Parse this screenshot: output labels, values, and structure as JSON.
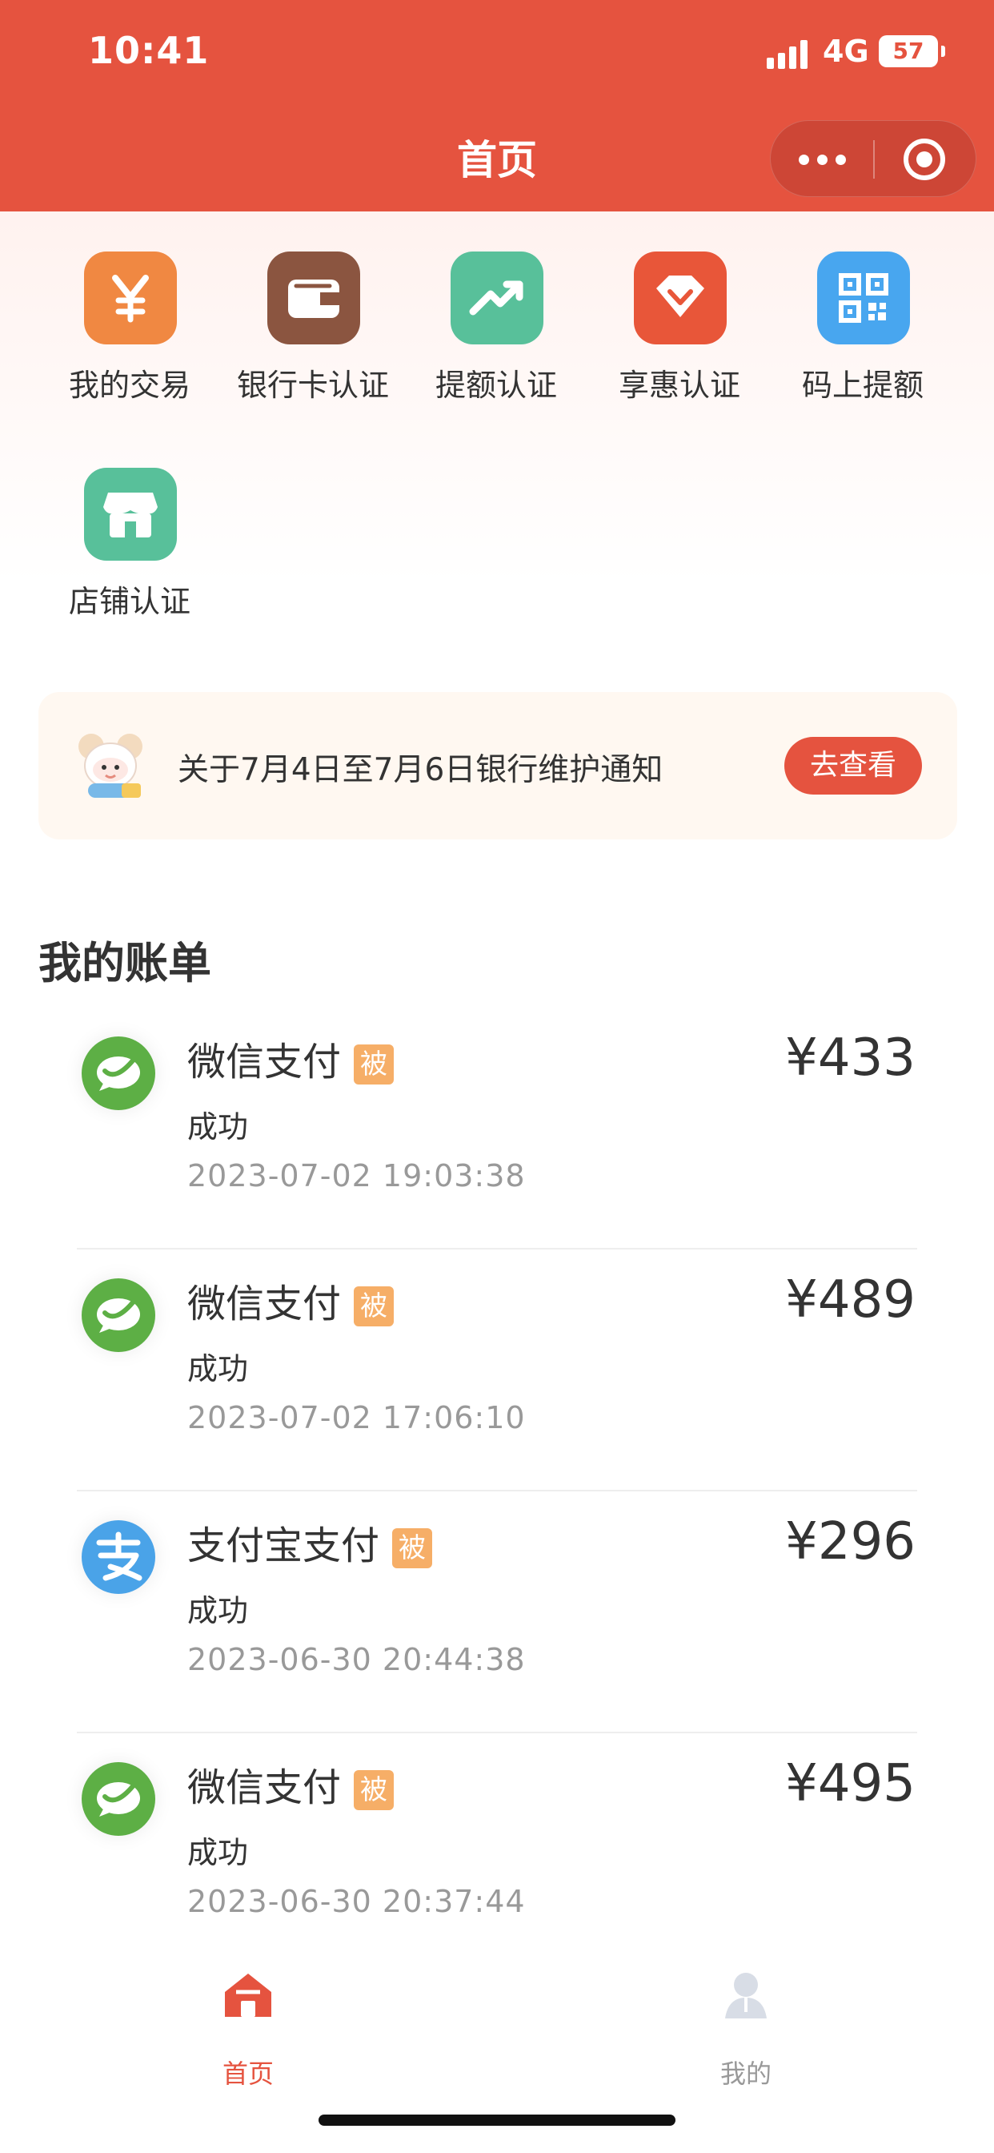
{
  "status_bar": {
    "time": "10:41",
    "network": "4G",
    "battery": "57"
  },
  "nav": {
    "title": "首页"
  },
  "menu": [
    {
      "label": "我的交易",
      "icon": "yen-icon",
      "color": "#f08842"
    },
    {
      "label": "银行卡认证",
      "icon": "wallet-icon",
      "color": "#8b5540"
    },
    {
      "label": "提额认证",
      "icon": "trend-up-icon",
      "color": "#58c09a"
    },
    {
      "label": "享惠认证",
      "icon": "diamond-tag-icon",
      "color": "#e85639"
    },
    {
      "label": "码上提额",
      "icon": "qr-code-icon",
      "color": "#48a6ef"
    },
    {
      "label": "店铺认证",
      "icon": "shop-icon",
      "color": "#58c09a"
    }
  ],
  "notice": {
    "text": "关于7月4日至7月6日银行维护通知",
    "button": "去查看"
  },
  "bills": {
    "title": "我的账单",
    "items": [
      {
        "name": "微信支付",
        "tag": "被",
        "status": "成功",
        "date": "2023-07-02 19:03:38",
        "amount": "¥433",
        "method": "wechat"
      },
      {
        "name": "微信支付",
        "tag": "被",
        "status": "成功",
        "date": "2023-07-02 17:06:10",
        "amount": "¥489",
        "method": "wechat"
      },
      {
        "name": "支付宝支付",
        "tag": "被",
        "status": "成功",
        "date": "2023-06-30 20:44:38",
        "amount": "¥296",
        "method": "alipay"
      },
      {
        "name": "微信支付",
        "tag": "被",
        "status": "成功",
        "date": "2023-06-30 20:37:44",
        "amount": "¥495",
        "method": "wechat"
      }
    ]
  },
  "tabs": [
    {
      "label": "首页",
      "active": true
    },
    {
      "label": "我的",
      "active": false
    }
  ],
  "colors": {
    "primary": "#e5533f",
    "tag": "#f6ae67",
    "wechat": "#5daf45",
    "alipay": "#4aa3e8"
  }
}
